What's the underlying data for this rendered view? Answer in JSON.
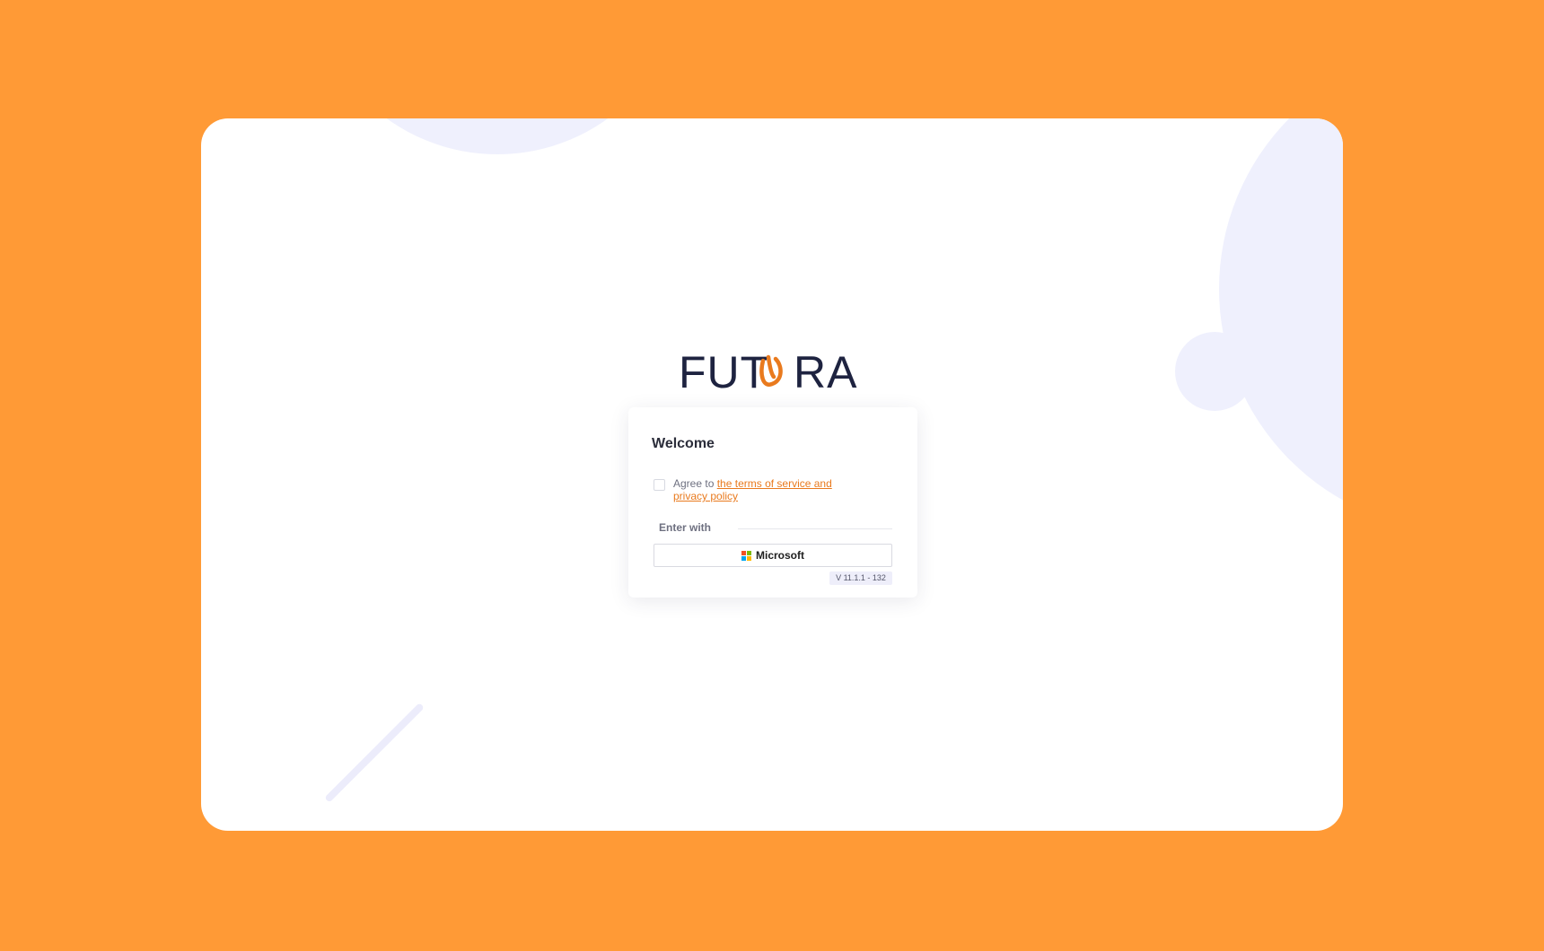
{
  "brand": {
    "logo_text": "FUTURA",
    "primary_color": "#1E2340",
    "accent_color": "#E97A1E",
    "background_color": "#FF9A36"
  },
  "login_card": {
    "title": "Welcome",
    "agree_prefix": "Agree to",
    "terms_link_text": "the terms of service and privacy policy",
    "enter_with_label": "Enter with",
    "microsoft_button_label": "Microsoft",
    "version_text": "V 11.1.1 - 132"
  },
  "icons": {
    "checkbox": "checkbox-unchecked",
    "microsoft": "microsoft-logo-icon"
  },
  "checkbox_state": {
    "checked": false
  }
}
